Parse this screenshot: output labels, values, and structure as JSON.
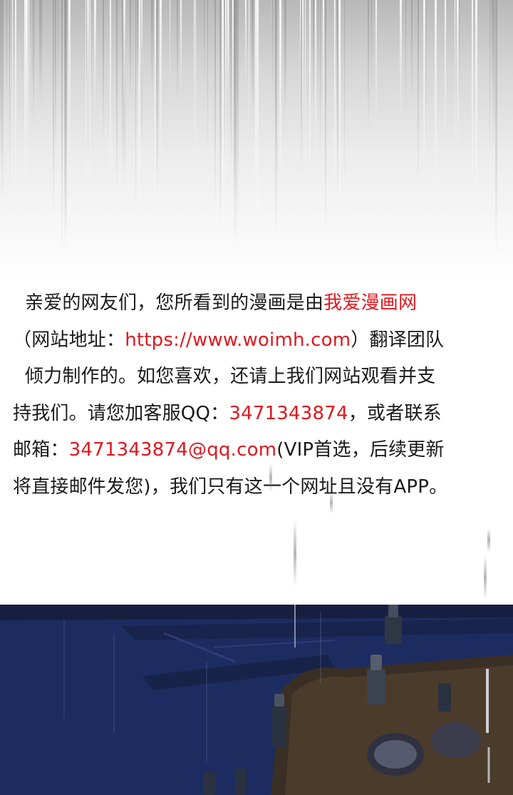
{
  "notice": {
    "line1": {
      "text": "亲爱的网友们，您所看到的漫画是由",
      "site_name": "我爱漫画网"
    },
    "line2": {
      "prefix": "（网站地址：",
      "url": "https://www.woimh.com",
      "suffix": "）翻译团队"
    },
    "line3": {
      "text": "倾力制作的。如您喜欢，还请上我们网站观看并支"
    },
    "line4": {
      "prefix": "持我们。请您加客服QQ：",
      "qq": "3471343874",
      "suffix": "，或者联系"
    },
    "line5": {
      "prefix": "邮箱：",
      "email": "3471343874@qq.com",
      "suffix": "(VIP首选，后续更新"
    },
    "line6": {
      "text": "将直接邮件发您)，我们只有这一个网址且没有APP。"
    }
  },
  "colors": {
    "text": "#1a1a1a",
    "highlight": "#e0181f",
    "night_sky": "#1e2f66"
  }
}
